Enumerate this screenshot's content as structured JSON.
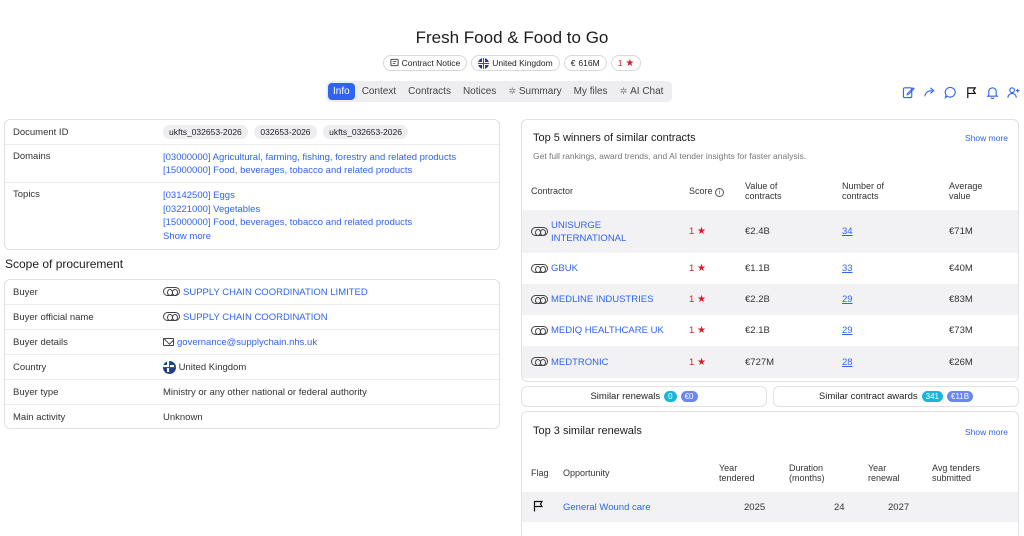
{
  "title": "Fresh Food & Food to Go",
  "badges": {
    "notice": "Contract Notice",
    "country": "United Kingdom",
    "value": "616M",
    "rating": "1"
  },
  "tabs": [
    {
      "label": "Info"
    },
    {
      "label": "Context"
    },
    {
      "label": "Contracts"
    },
    {
      "label": "Notices"
    },
    {
      "label": "Summary"
    },
    {
      "label": "My files"
    },
    {
      "label": "AI Chat"
    }
  ],
  "toolbar_icons": [
    "edit-icon",
    "share-icon",
    "comment-icon",
    "flag-icon",
    "bell-icon",
    "add-user-icon"
  ],
  "accent_color": "#2f64f0",
  "star_color": "#d61f2c",
  "info": {
    "document_id_label": "Document ID",
    "document_ids": [
      "ukfts_032653-2026",
      "032653-2026",
      "ukfts_032653-2026"
    ],
    "domains_label": "Domains",
    "domains": [
      "[03000000] Agricultural, farming, fishing, forestry and related products",
      "[15000000] Food, beverages, tobacco and related products"
    ],
    "topics_label": "Topics",
    "topics": [
      "[03142500] Eggs",
      "[03221000] Vegetables",
      "[15000000] Food, beverages, tobacco and related products"
    ],
    "topics_show_more": "Show more"
  },
  "scope": {
    "title": "Scope of procurement",
    "buyer_label": "Buyer",
    "buyer": "SUPPLY CHAIN COORDINATION LIMITED",
    "buyer_official_label": "Buyer official name",
    "buyer_official": "SUPPLY CHAIN COORDINATION",
    "buyer_details_label": "Buyer details",
    "buyer_details": "governance@supplychain.nhs.uk",
    "country_label": "Country",
    "country": "United Kingdom",
    "buyer_type_label": "Buyer type",
    "buyer_type": "Ministry or any other national or federal authority",
    "main_activity_label": "Main activity",
    "main_activity": "Unknown"
  },
  "winners": {
    "title": "Top 5 winners of similar contracts",
    "subtitle": "Get full rankings, award trends, and AI tender insights for faster analysis.",
    "show_more": "Show more",
    "columns": {
      "contractor": "Contractor",
      "score": "Score",
      "value_1": "Value of",
      "value_2": "contracts",
      "number_1": "Number of",
      "number_2": "contracts",
      "average_1": "Average",
      "average_2": "value"
    },
    "rows": [
      {
        "name_1": "UNISURGE",
        "name_2": "INTERNATIONAL",
        "score": "1",
        "value": "€2.4B",
        "number": "34",
        "average": "€71M"
      },
      {
        "name_1": "GBUK",
        "name_2": "",
        "score": "1",
        "value": "€1.1B",
        "number": "33",
        "average": "€40M"
      },
      {
        "name_1": "MEDLINE INDUSTRIES",
        "name_2": "",
        "score": "1",
        "value": "€2.2B",
        "number": "29",
        "average": "€83M"
      },
      {
        "name_1": "MEDIQ HEALTHCARE UK",
        "name_2": "",
        "score": "1",
        "value": "€2.1B",
        "number": "29",
        "average": "€73M"
      },
      {
        "name_1": "MEDTRONIC",
        "name_2": "",
        "score": "1",
        "value": "€727M",
        "number": "28",
        "average": "€26M"
      }
    ]
  },
  "similar_renewals_btn": {
    "label": "Similar renewals",
    "count": "0",
    "value": "€0"
  },
  "similar_awards_btn": {
    "label": "Similar contract awards",
    "count": "341",
    "value": "€11B"
  },
  "renewals": {
    "title": "Top 3 similar renewals",
    "show_more": "Show more",
    "columns": {
      "flag": "Flag",
      "opportunity": "Opportunity",
      "year_tendered_1": "Year",
      "year_tendered_2": "tendered",
      "duration_1": "Duration",
      "duration_2": "(months)",
      "year_renewal_1": "Year",
      "year_renewal_2": "renewal",
      "avg_1": "Avg tenders",
      "avg_2": "submitted"
    },
    "rows": [
      {
        "opportunity": "General Wound care",
        "year_tendered": "2025",
        "duration": "24",
        "year_renewal": "2027",
        "avg": ""
      }
    ]
  }
}
